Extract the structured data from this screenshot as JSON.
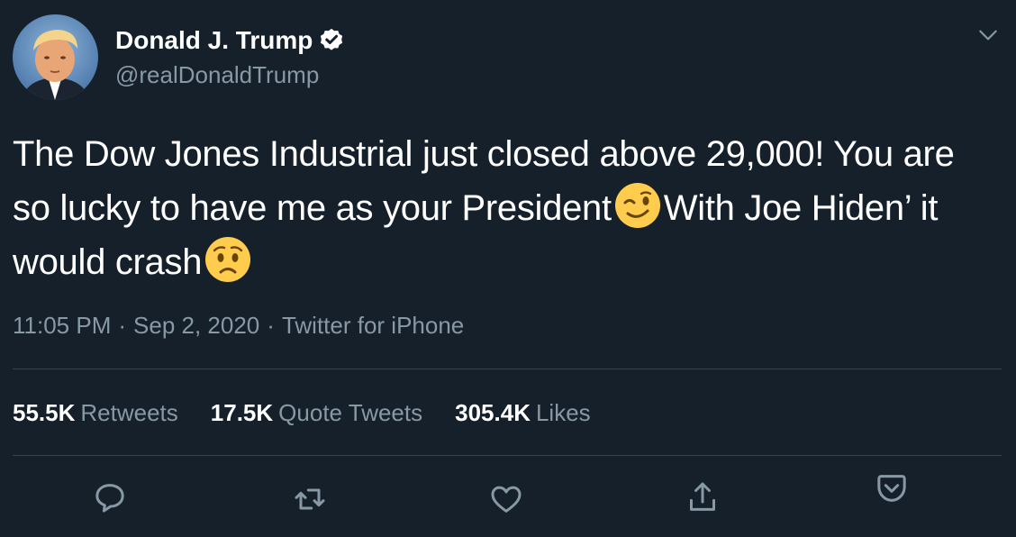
{
  "author": {
    "display_name": "Donald J. Trump",
    "handle": "@realDonaldTrump",
    "verified": true
  },
  "tweet": {
    "text_segments": [
      "The Dow Jones Industrial just closed above 29,000! You are so lucky to have me as your President",
      "With Joe Hiden’ it would crash"
    ],
    "emojis": [
      "winking-face-emoji",
      "worried-face-emoji"
    ]
  },
  "meta": {
    "time": "11:05 PM",
    "separator": "·",
    "date": "Sep 2, 2020",
    "source": "Twitter for iPhone"
  },
  "stats": {
    "retweets_count": "55.5K",
    "retweets_label": "Retweets",
    "quotes_count": "17.5K",
    "quotes_label": "Quote Tweets",
    "likes_count": "305.4K",
    "likes_label": "Likes"
  },
  "actions": [
    "reply-icon",
    "retweet-icon",
    "like-icon",
    "share-icon",
    "analytics-icon"
  ],
  "colors": {
    "background": "#15202b",
    "text": "#ffffff",
    "secondary": "#8899a6",
    "divider": "#38444d",
    "emoji": "#ffcc4d"
  }
}
